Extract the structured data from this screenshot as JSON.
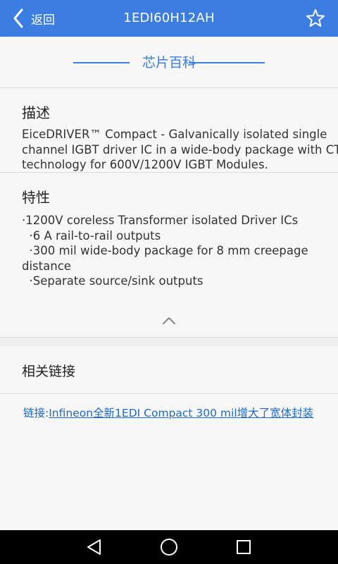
{
  "header": {
    "back_label": "返回",
    "title": "1EDI60H12AH"
  },
  "section_title": "芯片百科",
  "description": {
    "heading": "描述",
    "lines": [
      "EiceDRIVER™ Compact - Galvanically isolated single",
      "channel IGBT driver IC in a wide-body package with CT",
      "technology for 600V/1200V IGBT Modules."
    ]
  },
  "features": {
    "heading": "特性",
    "lines": [
      "·1200V coreless Transformer isolated Driver ICs",
      "  ·6 A rail-to-rail outputs",
      "  ·300 mil wide-body package for 8 mm creepage",
      "distance",
      "  ·Separate source/sink outputs"
    ]
  },
  "related": {
    "heading": "相关链接",
    "link_prefix": "链接:",
    "link_text": "Infineon全新1EDI Compact 300 mil增大了宽体封装"
  },
  "colors": {
    "accent": "#3b7de0",
    "link": "#1e69c7"
  },
  "icons": {
    "back": "chevron-left-icon",
    "favorite": "star-outline-icon",
    "collapse": "chevron-up-icon",
    "nav_back": "triangle-back-icon",
    "nav_home": "circle-home-icon",
    "nav_recent": "square-recent-icon"
  }
}
